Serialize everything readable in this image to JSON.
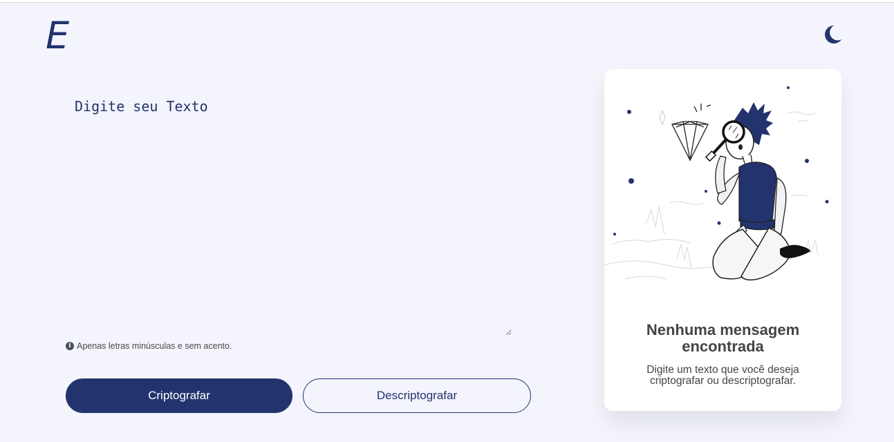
{
  "header": {
    "logo_text": "E",
    "theme_toggle_icon": "moon-icon"
  },
  "editor": {
    "placeholder": "Digite seu Texto",
    "value": "",
    "hint_icon": "info-icon",
    "hint": "Apenas letras minúsculas e sem acento."
  },
  "actions": {
    "encrypt_label": "Criptografar",
    "decrypt_label": "Descriptografar"
  },
  "result": {
    "illustration": "person-with-magnifying-glass-diamond-illustration",
    "title": "Nenhuma mensagem encontrada",
    "subtitle": "Digite um texto que você deseja criptografar ou descriptografar."
  },
  "colors": {
    "background": "#f3f4fc",
    "accent": "#23336d",
    "card": "#ffffff",
    "text": "#444444"
  }
}
